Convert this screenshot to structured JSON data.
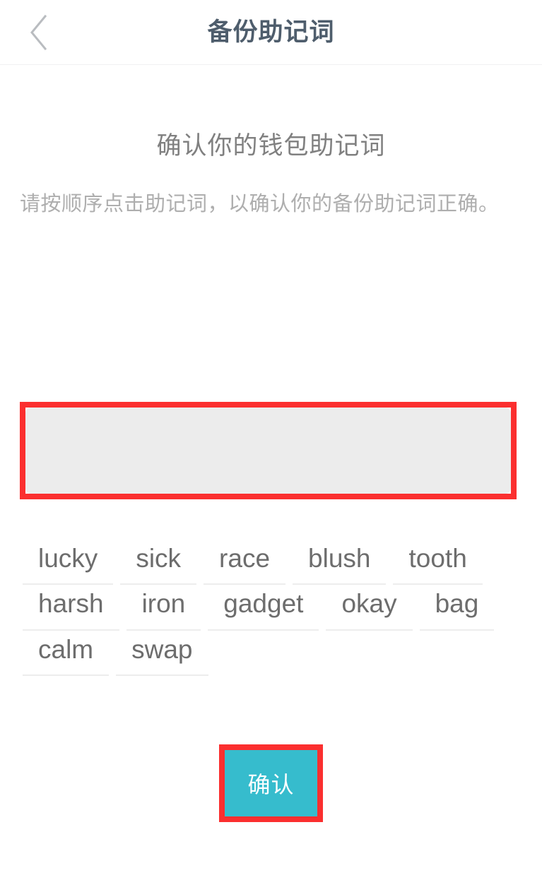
{
  "header": {
    "title": "备份助记词",
    "back_icon": "chevron-left-icon"
  },
  "main": {
    "section_title": "确认你的钱包助记词",
    "section_desc": "请按顺序点击助记词，以确认你的备份助记词正确。",
    "selected_words": [],
    "selected_box_placeholder": "",
    "word_bank": [
      [
        "lucky",
        "sick",
        "race",
        "blush",
        "tooth"
      ],
      [
        "harsh",
        "iron",
        "gadget",
        "okay",
        "bag"
      ],
      [
        "calm",
        "swap"
      ]
    ],
    "confirm_label": "确认"
  },
  "colors": {
    "header_title": "#4e5d6c",
    "section_title": "#808080",
    "section_desc": "#aeaeae",
    "word_text": "#6d6d6d",
    "word_underline": "#ededed",
    "selected_box_bg": "#ececec",
    "confirm_bg": "#36bccd",
    "confirm_text": "#ffffff",
    "annotation_border": "#fb2f2f",
    "page_bg": "#ffffff",
    "header_divider": "#f0f1f2"
  }
}
